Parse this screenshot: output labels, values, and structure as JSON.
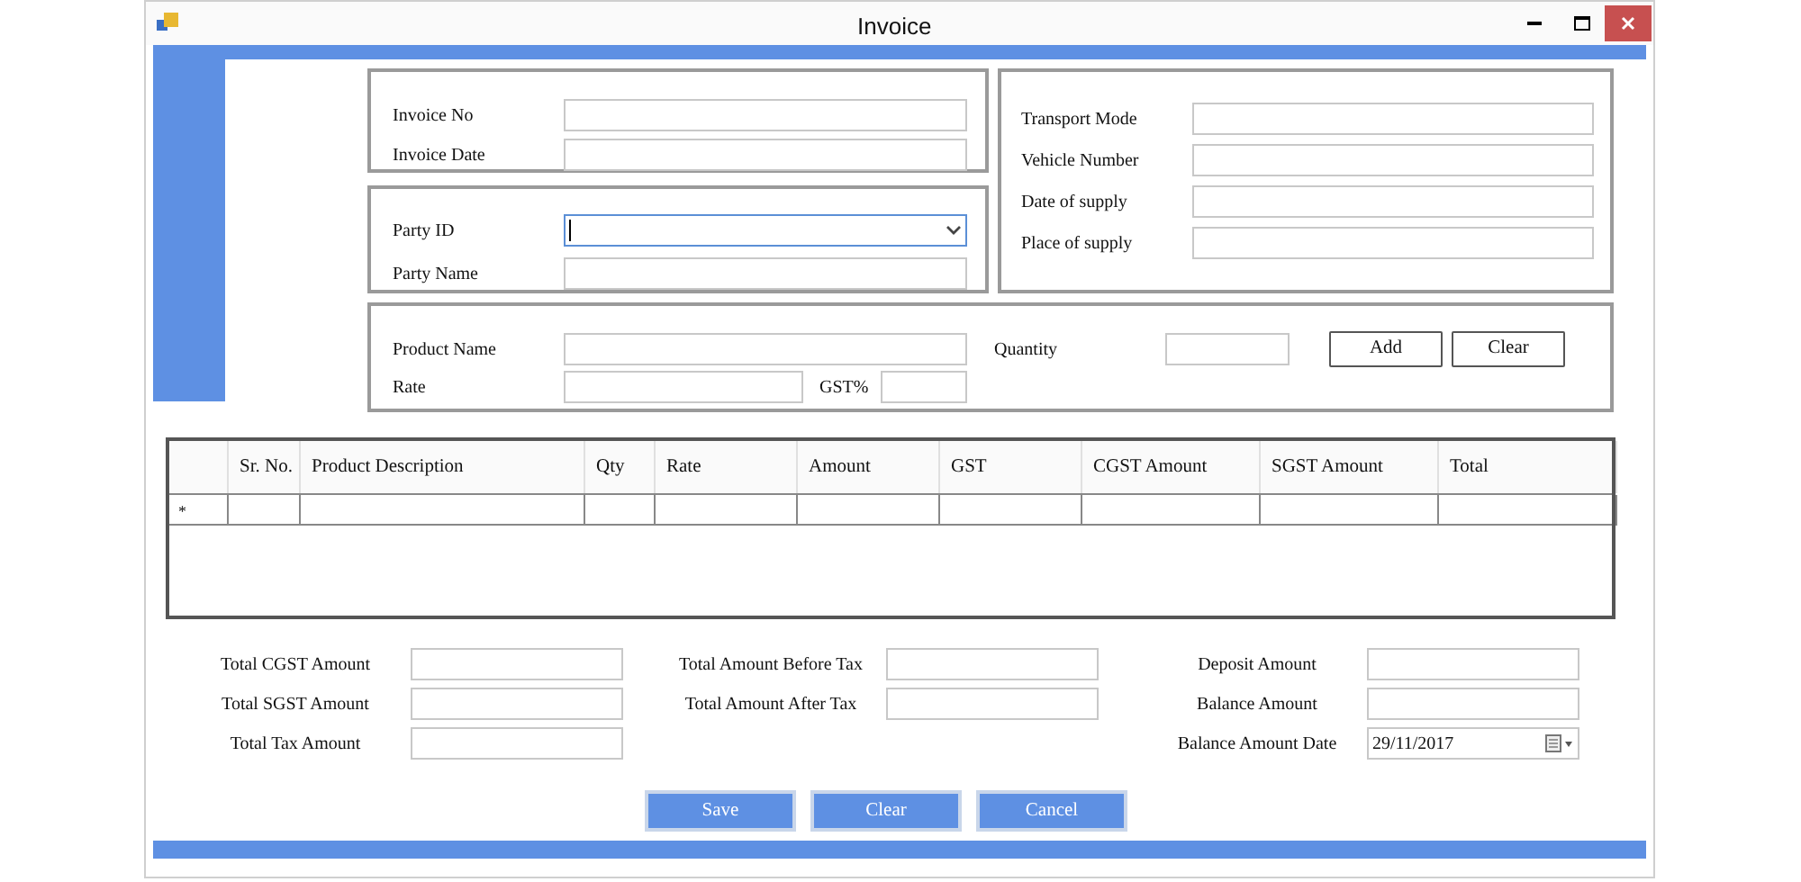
{
  "window": {
    "title": "Invoice"
  },
  "invoice_box": {
    "fields": [
      {
        "label": "Invoice No"
      },
      {
        "label": "Invoice Date"
      }
    ]
  },
  "party_box": {
    "fields": [
      {
        "label": "Party ID",
        "kind": "dropdown",
        "focused": true
      },
      {
        "label": "Party Name",
        "kind": "text",
        "focused": false
      }
    ]
  },
  "transport_box": {
    "fields": [
      {
        "label": "Transport Mode"
      },
      {
        "label": "Vehicle Number"
      },
      {
        "label": "Date of supply"
      },
      {
        "label": "Place of supply"
      }
    ]
  },
  "product_box": {
    "product_name": {
      "label": "Product Name"
    },
    "rate": {
      "label": "Rate"
    },
    "gst": {
      "label": "GST%"
    },
    "quantity": {
      "label": "Quantity"
    },
    "buttons": [
      "Add",
      "Clear"
    ]
  },
  "grid": {
    "columns": [
      "Sr. No.",
      "Product Description",
      "Qty",
      "Rate",
      "Amount",
      "GST",
      "CGST Amount",
      "SGST Amount",
      "Total"
    ],
    "rows": [
      {
        "marker": "*"
      }
    ]
  },
  "totals": {
    "columns": [
      [
        {
          "label": "Total CGST Amount",
          "kind": "text"
        },
        {
          "label": "Total SGST Amount",
          "kind": "text"
        },
        {
          "label": "Total Tax Amount",
          "kind": "text"
        }
      ],
      [
        {
          "label": "Total Amount Before Tax",
          "kind": "text"
        },
        {
          "label": "Total Amount After Tax",
          "kind": "text"
        }
      ],
      [
        {
          "label": "Deposit Amount",
          "kind": "text"
        },
        {
          "label": "Balance Amount",
          "kind": "text"
        },
        {
          "label": "Balance Amount Date",
          "kind": "date",
          "value": "29/11/2017"
        }
      ]
    ]
  },
  "buttons": [
    "Save",
    "Clear",
    "Cancel"
  ]
}
